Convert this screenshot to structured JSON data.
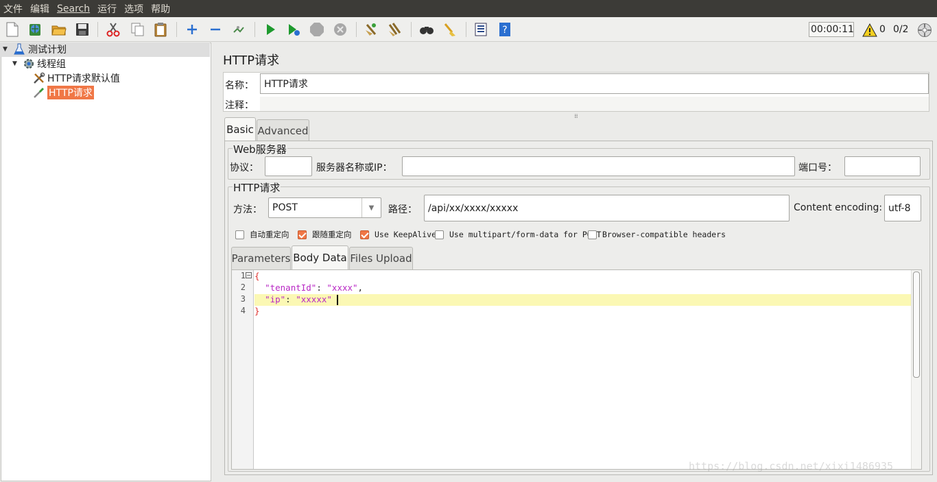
{
  "menu": [
    "文件",
    "编辑",
    "Search",
    "运行",
    "选项",
    "帮助"
  ],
  "toolbar": {
    "timer": "00:00:11",
    "warning_count": "0",
    "thread_count": "0/2",
    "icons": [
      "new-icon",
      "templates-icon",
      "open-icon",
      "save-icon",
      "cut-icon",
      "copy-icon",
      "paste-icon",
      "expand-icon",
      "collapse-icon",
      "toggle-icon",
      "start-icon",
      "start-no-pause-icon",
      "stop-icon",
      "shutdown-icon",
      "clear-icon",
      "clear-all-icon",
      "search-icon",
      "reset-search-icon",
      "function-helper-icon",
      "help-icon"
    ]
  },
  "tree": {
    "items": [
      {
        "label": "测试计划",
        "icon": "flask-icon"
      },
      {
        "label": "线程组",
        "icon": "gear-icon"
      },
      {
        "label": "HTTP请求默认值",
        "icon": "wrench-icon"
      },
      {
        "label": "HTTP请求",
        "icon": "pipette-icon"
      }
    ]
  },
  "panel": {
    "title": "HTTP请求",
    "name_label": "名称：",
    "name_value": "HTTP请求",
    "comment_label": "注释："
  },
  "tabs": {
    "basic": "Basic",
    "advanced": "Advanced"
  },
  "web_server": {
    "title": "Web服务器",
    "protocol_label": "协议：",
    "protocol_value": "",
    "server_label": "服务器名称或IP：",
    "server_value": "",
    "port_label": "端口号：",
    "port_value": ""
  },
  "http_request": {
    "title": "HTTP请求",
    "method_label": "方法：",
    "method_value": "POST",
    "path_label": "路径：",
    "path_value": "/api/xx/xxxx/xxxxx",
    "encoding_label": "Content encoding:",
    "encoding_value": "utf-8"
  },
  "options": [
    {
      "label": "自动重定向",
      "checked": false
    },
    {
      "label": "跟随重定向",
      "checked": true
    },
    {
      "label": "Use KeepAlive",
      "checked": true
    },
    {
      "label": "Use multipart/form-data for POST",
      "checked": false
    },
    {
      "label": "Browser-compatible headers",
      "checked": false
    }
  ],
  "inner_tabs": {
    "parameters": "Parameters",
    "body_data": "Body Data",
    "files_upload": "Files Upload"
  },
  "editor": {
    "line_numbers": [
      "1",
      "2",
      "3",
      "4"
    ],
    "line1": "{",
    "line2_key": "\"tenantId\"",
    "line2_sep": ": ",
    "line2_val": "\"xxxx\"",
    "line2_end": ",",
    "line3_key": "\"ip\"",
    "line3_sep": ": ",
    "line3_val": "\"xxxxx\"",
    "line4": "}"
  },
  "watermark": "https://blog.csdn.net/xixi1486935"
}
